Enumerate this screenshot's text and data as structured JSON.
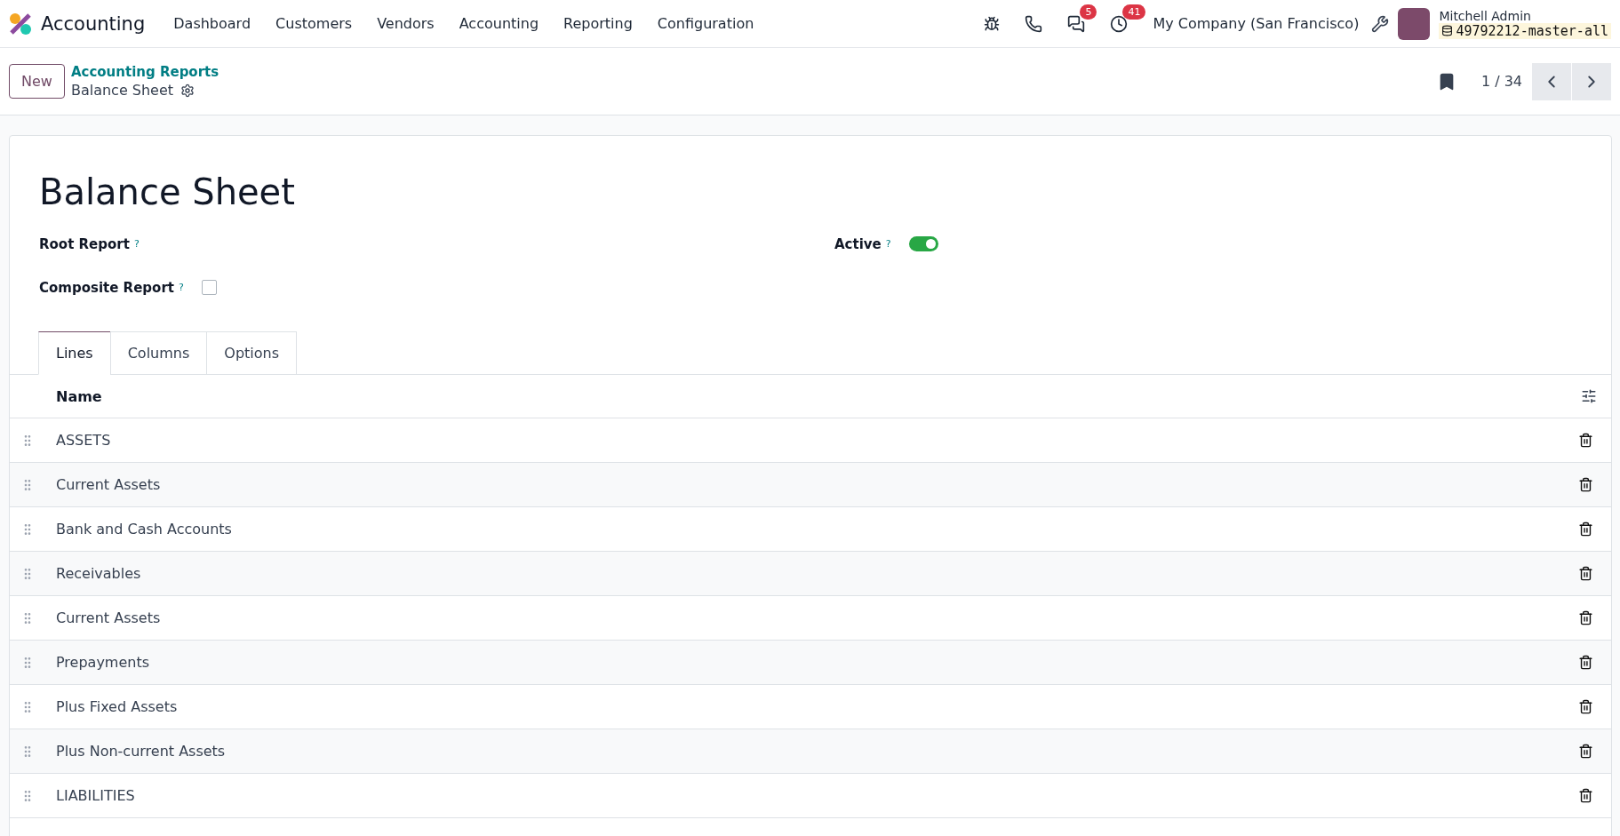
{
  "navbar": {
    "app_name": "Accounting",
    "menu": [
      "Dashboard",
      "Customers",
      "Vendors",
      "Accounting",
      "Reporting",
      "Configuration"
    ],
    "messages_count": "5",
    "activities_count": "41",
    "company": "My Company (San Francisco)",
    "user_name": "Mitchell Admin",
    "database": "49792212-master-all"
  },
  "control_panel": {
    "new_button": "New",
    "breadcrumb_parent": "Accounting Reports",
    "breadcrumb_current": "Balance Sheet",
    "pager": "1 / 34"
  },
  "form": {
    "title": "Balance Sheet",
    "fields": [
      {
        "label": "Root Report",
        "help": "?"
      },
      {
        "label": "Composite Report",
        "help": "?",
        "kind": "checkbox",
        "checked": false
      }
    ],
    "active": {
      "label": "Active",
      "help": "?",
      "on": true
    },
    "tabs": [
      {
        "label": "Lines",
        "selected": true
      },
      {
        "label": "Columns",
        "selected": false
      },
      {
        "label": "Options",
        "selected": false
      }
    ],
    "table": {
      "columns": [
        "Name"
      ],
      "rows": [
        {
          "name": "ASSETS"
        },
        {
          "name": "Current Assets"
        },
        {
          "name": "Bank and Cash Accounts"
        },
        {
          "name": "Receivables"
        },
        {
          "name": "Current Assets"
        },
        {
          "name": "Prepayments"
        },
        {
          "name": "Plus Fixed Assets"
        },
        {
          "name": "Plus Non-current Assets"
        },
        {
          "name": "LIABILITIES"
        }
      ]
    }
  }
}
